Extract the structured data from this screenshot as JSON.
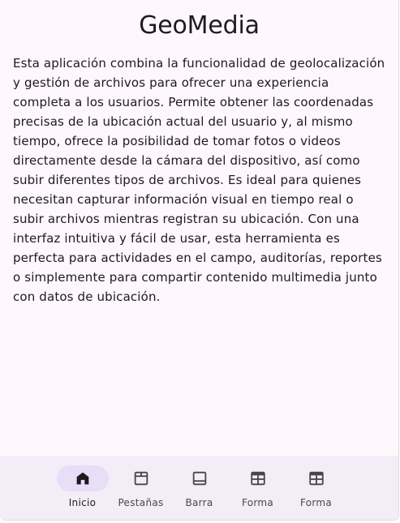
{
  "app": {
    "title": "GeoMedia"
  },
  "description": "Esta aplicación combina la funcionalidad de geolocalización y gestión de archivos para ofrecer una experiencia completa a los usuarios. Permite obtener las coordenadas precisas de la ubicación actual del usuario y, al mismo tiempo, ofrece la posibilidad de tomar fotos o videos directamente desde la cámara del dispositivo, así como subir diferentes tipos de archivos. Es ideal para quienes necesitan capturar información visual en tiempo real o subir archivos mientras registran su ubicación. Con una interfaz intuitiva y fácil de usar, esta herramienta es perfecta para actividades en el campo, auditorías, reportes o simplemente para compartir contenido multimedia junto con datos de ubicación.",
  "nav": {
    "items": [
      {
        "label": "Inicio",
        "icon": "home-icon",
        "active": true
      },
      {
        "label": "Pestañas",
        "icon": "tabs-icon",
        "active": false
      },
      {
        "label": "Barra",
        "icon": "bottom-bar-icon",
        "active": false
      },
      {
        "label": "Forma",
        "icon": "form-icon",
        "active": false
      },
      {
        "label": "Forma",
        "icon": "form-icon",
        "active": false
      }
    ]
  },
  "colors": {
    "background": "#fef7fc",
    "nav_background": "#f3edf7",
    "active_indicator": "#e8def8",
    "text": "#1d1b20"
  }
}
